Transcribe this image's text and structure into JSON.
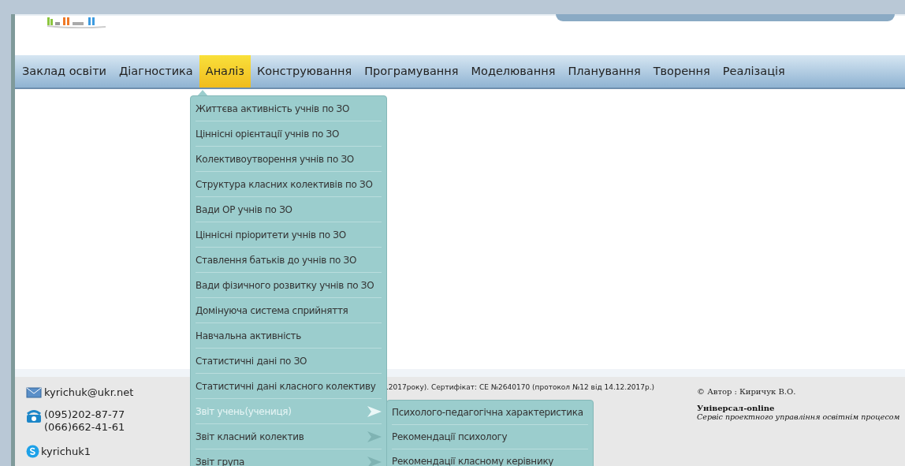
{
  "nav": [
    {
      "label": "Заклад освіти",
      "selected": false
    },
    {
      "label": "Діагностика",
      "selected": false
    },
    {
      "label": "Аналіз",
      "selected": true
    },
    {
      "label": "Конструювання",
      "selected": false
    },
    {
      "label": "Програмування",
      "selected": false
    },
    {
      "label": "Моделювання",
      "selected": false
    },
    {
      "label": "Планування",
      "selected": false
    },
    {
      "label": "Творення",
      "selected": false
    },
    {
      "label": "Реалізація",
      "selected": false
    }
  ],
  "dropdown": [
    {
      "label": "Життєва активність учнів по ЗО",
      "kind": "link",
      "selected": false
    },
    {
      "label": "Ціннісні орієнтації учнів по ЗО",
      "kind": "link",
      "selected": false
    },
    {
      "label": "Колективоутворення учнів по ЗО",
      "kind": "link",
      "selected": false
    },
    {
      "label": "Структура класних колективів по ЗО",
      "kind": "link",
      "selected": false
    },
    {
      "label": "Вади ОР учнів по ЗО",
      "kind": "link",
      "selected": false
    },
    {
      "label": "Ціннісні пріоритети учнів по ЗО",
      "kind": "link",
      "selected": false
    },
    {
      "label": "Ставлення батьків до учнів по ЗО",
      "kind": "link",
      "selected": false
    },
    {
      "label": "Вади фізичного розвитку учнів по ЗО",
      "kind": "link",
      "selected": false
    },
    {
      "label": "Домінуюча система сприйняття",
      "kind": "link",
      "selected": false
    },
    {
      "label": "Навчальна активність",
      "kind": "link",
      "selected": false
    },
    {
      "label": "Статистичні дані по ЗО",
      "kind": "link",
      "selected": false
    },
    {
      "label": "Статистичні дані класного колективу",
      "kind": "link",
      "selected": false
    },
    {
      "label": "Звіт учень(учениця)",
      "kind": "submenu",
      "selected": true
    },
    {
      "label": "Звіт класний колектив",
      "kind": "submenu",
      "selected": false
    },
    {
      "label": "Звіт група",
      "kind": "submenu",
      "selected": false
    }
  ],
  "submenu": [
    "Психолого-педагогічна характеристика",
    "Рекомендації психологу",
    "Рекомендації класному керівнику"
  ],
  "footer": {
    "email": "kyrichuk@ukr.net",
    "phones": [
      "(095)202-87-77",
      "(066)662-41-61"
    ],
    "skype": "kyrichuk1",
    "certificate": ".2017року). Сертифікат: СЕ №2640170 (протокол №12 від 14.12.2017р.)",
    "author": "© Автор : Киричук В.О.",
    "brand": "Універсал-online",
    "tagline": "Сервіс проектного управління освітнім процесом"
  }
}
